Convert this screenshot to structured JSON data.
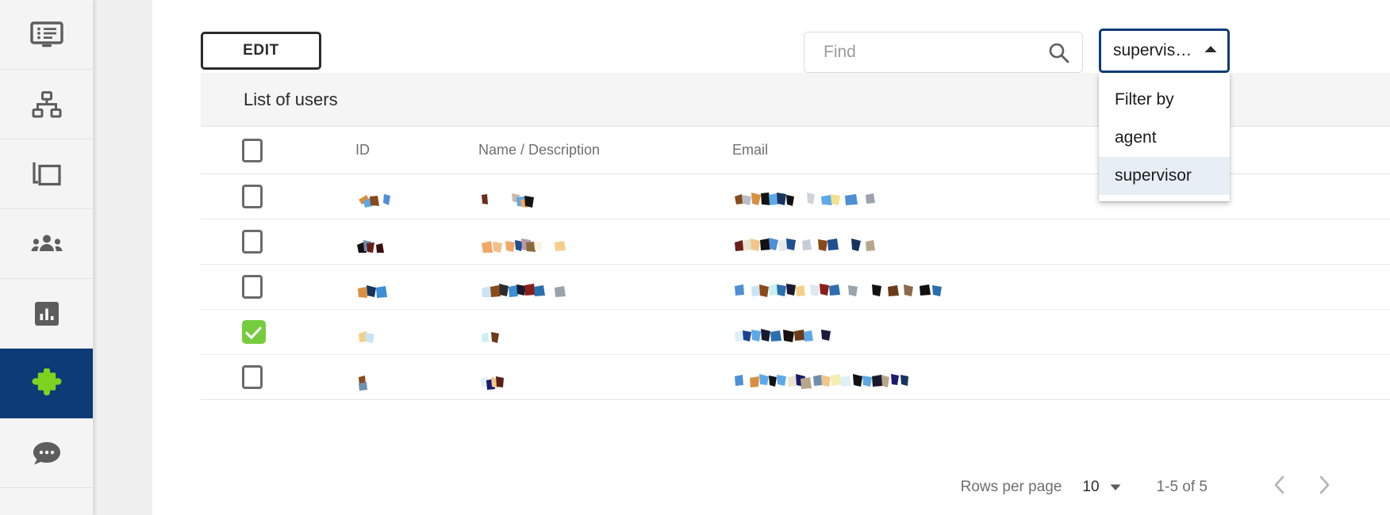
{
  "sidebar": {
    "items": [
      {
        "name": "dashboard",
        "icon": "monitor-list-icon",
        "active": false
      },
      {
        "name": "topology",
        "icon": "sitemap-icon",
        "active": false
      },
      {
        "name": "windows",
        "icon": "copy-windows-icon",
        "active": false
      },
      {
        "name": "users",
        "icon": "people-group-icon",
        "active": false
      },
      {
        "name": "reports",
        "icon": "bar-chart-icon",
        "active": false
      },
      {
        "name": "plugins",
        "icon": "puzzle-piece-icon",
        "active": true
      },
      {
        "name": "chat",
        "icon": "chat-bubble-icon",
        "active": false
      }
    ],
    "active_background": "#0d3b78",
    "active_icon_color": "#7ed321"
  },
  "toolbar": {
    "edit_label": "EDIT"
  },
  "search": {
    "value": "",
    "placeholder": "Find",
    "icon": "search-icon"
  },
  "filter": {
    "selected_display": "supervis…",
    "expanded": true,
    "caret_icon": "chevron-up-icon",
    "options": [
      {
        "label": "Filter by",
        "selected": false
      },
      {
        "label": "agent",
        "selected": false
      },
      {
        "label": "supervisor",
        "selected": true
      }
    ],
    "accent_color": "#0d3b78",
    "highlight_color": "#e8eef5"
  },
  "table": {
    "title": "List of users",
    "columns": [
      {
        "key": "select",
        "label": ""
      },
      {
        "key": "id",
        "label": "ID"
      },
      {
        "key": "name",
        "label": "Name / Description"
      },
      {
        "key": "email",
        "label": "Email"
      }
    ],
    "header_checkbox_checked": false,
    "rows": [
      {
        "selected": false,
        "id": "",
        "name": "",
        "email": ""
      },
      {
        "selected": false,
        "id": "",
        "name": "",
        "email": ""
      },
      {
        "selected": false,
        "id": "",
        "name": "",
        "email": ""
      },
      {
        "selected": true,
        "id": "",
        "name": "",
        "email": ""
      },
      {
        "selected": false,
        "id": "",
        "name": "",
        "email": ""
      }
    ],
    "checkbox_checked_color": "#76cc3f"
  },
  "pagination": {
    "rows_per_page_label": "Rows per page",
    "rows_per_page_value": "10",
    "rows_per_page_caret": "chevron-down-icon",
    "range_label": "1-5 of 5",
    "prev_icon": "chevron-left-icon",
    "next_icon": "chevron-right-icon"
  }
}
